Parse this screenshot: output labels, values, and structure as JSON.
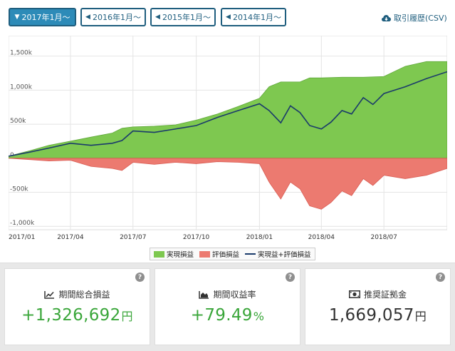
{
  "periods": [
    {
      "label": "2017年1月〜",
      "active": true,
      "icon": "caret-down-icon"
    },
    {
      "label": "2016年1月〜",
      "active": false,
      "icon": "caret-left-icon"
    },
    {
      "label": "2015年1月〜",
      "active": false,
      "icon": "caret-left-icon"
    },
    {
      "label": "2014年1月〜",
      "active": false,
      "icon": "caret-left-icon"
    }
  ],
  "export_label": "取引履歴(CSV)",
  "chart_data": {
    "type": "area",
    "y_ticks": [
      "1,500k",
      "1,000k",
      "500k",
      "0",
      "-500k",
      "-1,000k"
    ],
    "y_tick_values": [
      1500000,
      1000000,
      500000,
      0,
      -500000,
      -1000000
    ],
    "ylim": [
      -1050000,
      1800000
    ],
    "x_tick_labels": [
      "2017/01",
      "2017/04",
      "2017/07",
      "2017/10",
      "2018/01",
      "2018/04",
      "2018/07"
    ],
    "x_tick_dates": [
      "2017-01-01",
      "2017-04-01",
      "2017-07-01",
      "2017-10-01",
      "2018-01-01",
      "2018-04-01",
      "2018-07-01"
    ],
    "xlim": [
      "2017-01-01",
      "2018-10-01"
    ],
    "grid": true,
    "legend_position": "bottom",
    "colors": {
      "realized": "#7ec850",
      "unrealized": "#ec7a70",
      "total": "#1a3a6b"
    },
    "series": [
      {
        "name": "実現損益",
        "key": "realized",
        "dates": [
          "2017-01-01",
          "2017-02-01",
          "2017-03-01",
          "2017-04-01",
          "2017-05-01",
          "2017-06-01",
          "2017-06-15",
          "2017-07-01",
          "2017-08-01",
          "2017-09-01",
          "2017-10-01",
          "2017-11-01",
          "2017-12-01",
          "2018-01-01",
          "2018-01-15",
          "2018-02-01",
          "2018-03-01",
          "2018-03-15",
          "2018-04-01",
          "2018-05-01",
          "2018-06-01",
          "2018-07-01",
          "2018-08-01",
          "2018-09-01",
          "2018-10-01"
        ],
        "values": [
          30000,
          110000,
          190000,
          250000,
          310000,
          370000,
          440000,
          460000,
          470000,
          490000,
          560000,
          650000,
          760000,
          880000,
          1050000,
          1120000,
          1120000,
          1180000,
          1180000,
          1190000,
          1190000,
          1200000,
          1350000,
          1420000,
          1420000
        ]
      },
      {
        "name": "評価損益",
        "key": "unrealized",
        "dates": [
          "2017-01-01",
          "2017-02-01",
          "2017-03-01",
          "2017-04-01",
          "2017-05-01",
          "2017-06-01",
          "2017-06-15",
          "2017-07-01",
          "2017-08-01",
          "2017-09-01",
          "2017-10-01",
          "2017-11-01",
          "2017-12-01",
          "2018-01-01",
          "2018-01-15",
          "2018-02-01",
          "2018-02-15",
          "2018-03-01",
          "2018-03-15",
          "2018-04-01",
          "2018-04-15",
          "2018-05-01",
          "2018-05-15",
          "2018-06-01",
          "2018-06-15",
          "2018-07-01",
          "2018-08-01",
          "2018-09-01",
          "2018-10-01"
        ],
        "values": [
          0,
          -20000,
          -40000,
          -30000,
          -120000,
          -150000,
          -180000,
          -60000,
          -90000,
          -60000,
          -80000,
          -50000,
          -60000,
          -80000,
          -350000,
          -600000,
          -350000,
          -450000,
          -700000,
          -750000,
          -650000,
          -480000,
          -550000,
          -300000,
          -400000,
          -250000,
          -300000,
          -250000,
          -150000
        ]
      },
      {
        "name": "実現益+評価損益",
        "key": "total",
        "dates": [
          "2017-01-01",
          "2017-02-01",
          "2017-03-01",
          "2017-04-01",
          "2017-05-01",
          "2017-06-01",
          "2017-06-15",
          "2017-07-01",
          "2017-08-01",
          "2017-09-01",
          "2017-10-01",
          "2017-11-01",
          "2017-12-01",
          "2018-01-01",
          "2018-01-15",
          "2018-02-01",
          "2018-02-15",
          "2018-03-01",
          "2018-03-15",
          "2018-04-01",
          "2018-04-15",
          "2018-05-01",
          "2018-05-15",
          "2018-06-01",
          "2018-06-15",
          "2018-07-01",
          "2018-08-01",
          "2018-09-01",
          "2018-10-01"
        ],
        "values": [
          30000,
          90000,
          150000,
          220000,
          190000,
          220000,
          260000,
          400000,
          380000,
          430000,
          480000,
          600000,
          700000,
          800000,
          700000,
          520000,
          770000,
          670000,
          480000,
          430000,
          530000,
          700000,
          650000,
          890000,
          790000,
          950000,
          1050000,
          1170000,
          1270000
        ]
      }
    ]
  },
  "legend": [
    {
      "label": "実現損益",
      "color": "#7ec850"
    },
    {
      "label": "評価損益",
      "color": "#ec7a70"
    },
    {
      "label": "実現益+評価損益",
      "color": "#1a3a6b"
    }
  ],
  "cards": [
    {
      "title": "期間総合損益",
      "value": "+1,326,692",
      "unit": "円",
      "color": "green",
      "icon": "line-chart-icon"
    },
    {
      "title": "期間収益率",
      "value": "+79.49",
      "unit": "%",
      "color": "green",
      "icon": "area-chart-icon"
    },
    {
      "title": "推奨証拠金",
      "value": "1,669,057",
      "unit": "円",
      "color": "dark",
      "icon": "money-icon"
    }
  ],
  "help_label": "?"
}
